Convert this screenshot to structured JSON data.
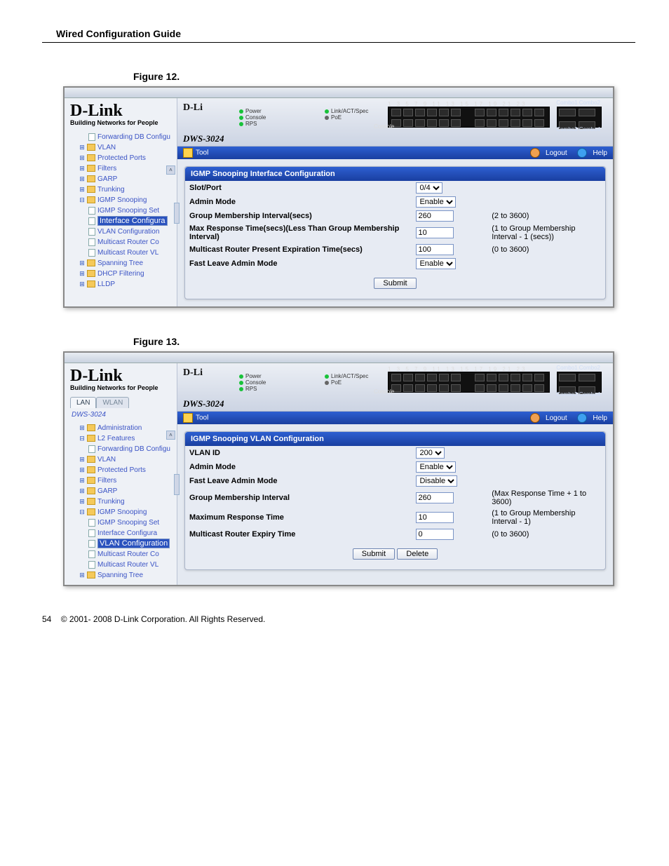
{
  "doc": {
    "header": "Wired Configuration Guide",
    "fig12": "Figure 12.",
    "fig13": "Figure 13.",
    "page_num": "54",
    "copyright": "© 2001- 2008 D-Link Corporation. All Rights Reserved."
  },
  "brand": {
    "logo": "D-Link",
    "tagline": "Building Networks for People",
    "mini": "D-Li",
    "model": "DWS-3024"
  },
  "device": {
    "leds": {
      "power": "Power",
      "console": "Console",
      "rps": "RPS",
      "linkact": "Link/ACT/Spec",
      "poe": "PoE"
    },
    "top_nums": "1   3   5   7   9   11        13   15   17   19   21  23",
    "bot_nums": "2   4   6   8  10  12        14  16  18  20  22  24",
    "console_port": "Console",
    "combo_top": "Combo1 Combo2",
    "combo_bot": "Combo3 Combo4"
  },
  "toolbar": {
    "tool": "Tool",
    "logout": "Logout",
    "help": "Help"
  },
  "tabs": {
    "lan": "LAN",
    "wlan": "WLAN"
  },
  "tree12": [
    {
      "lvl": 2,
      "kind": "page",
      "text": "Forwarding DB Configu"
    },
    {
      "lvl": 1,
      "kind": "folder",
      "text": "VLAN"
    },
    {
      "lvl": 1,
      "kind": "folder",
      "text": "Protected Ports"
    },
    {
      "lvl": 1,
      "kind": "folder",
      "text": "Filters"
    },
    {
      "lvl": 1,
      "kind": "folder",
      "text": "GARP"
    },
    {
      "lvl": 1,
      "kind": "folder",
      "text": "Trunking"
    },
    {
      "lvl": 1,
      "kind": "folder-open",
      "text": "IGMP Snooping"
    },
    {
      "lvl": 2,
      "kind": "page",
      "text": "IGMP Snooping Set"
    },
    {
      "lvl": 2,
      "kind": "page",
      "text": "Interface Configura",
      "sel": true
    },
    {
      "lvl": 2,
      "kind": "page",
      "text": "VLAN Configuration"
    },
    {
      "lvl": 2,
      "kind": "page",
      "text": "Multicast Router Co"
    },
    {
      "lvl": 2,
      "kind": "page",
      "text": "Multicast Router VL"
    },
    {
      "lvl": 1,
      "kind": "folder",
      "text": "Spanning Tree"
    },
    {
      "lvl": 1,
      "kind": "folder",
      "text": "DHCP Filtering"
    },
    {
      "lvl": 1,
      "kind": "folder",
      "text": "LLDP"
    }
  ],
  "tree13": [
    {
      "lvl": 0,
      "kind": "device",
      "text": "DWS-3024"
    },
    {
      "lvl": 1,
      "kind": "folder",
      "text": "Administration"
    },
    {
      "lvl": 1,
      "kind": "folder-open",
      "text": "L2 Features"
    },
    {
      "lvl": 2,
      "kind": "page",
      "text": "Forwarding DB Configu"
    },
    {
      "lvl": 1,
      "kind": "folder",
      "text": "VLAN"
    },
    {
      "lvl": 1,
      "kind": "folder",
      "text": "Protected Ports"
    },
    {
      "lvl": 1,
      "kind": "folder",
      "text": "Filters"
    },
    {
      "lvl": 1,
      "kind": "folder",
      "text": "GARP"
    },
    {
      "lvl": 1,
      "kind": "folder",
      "text": "Trunking"
    },
    {
      "lvl": 1,
      "kind": "folder-open",
      "text": "IGMP Snooping"
    },
    {
      "lvl": 2,
      "kind": "page",
      "text": "IGMP Snooping Set"
    },
    {
      "lvl": 2,
      "kind": "page",
      "text": "Interface Configura"
    },
    {
      "lvl": 2,
      "kind": "page",
      "text": "VLAN Configuration",
      "sel": true
    },
    {
      "lvl": 2,
      "kind": "page",
      "text": "Multicast Router Co"
    },
    {
      "lvl": 2,
      "kind": "page",
      "text": "Multicast Router VL"
    },
    {
      "lvl": 1,
      "kind": "folder",
      "text": "Spanning Tree"
    }
  ],
  "fig12": {
    "title": "IGMP Snooping Interface Configuration",
    "rows": [
      {
        "label": "Slot/Port",
        "ctrl": "select",
        "value": "0/4",
        "hint": ""
      },
      {
        "label": "Admin Mode",
        "ctrl": "select",
        "value": "Enable",
        "hint": ""
      },
      {
        "label": "Group Membership Interval(secs)",
        "ctrl": "input",
        "value": "260",
        "hint": "(2 to 3600)"
      },
      {
        "label": "Max Response Time(secs)(Less Than Group Membership Interval)",
        "ctrl": "input",
        "value": "10",
        "hint": "(1 to Group Membership Interval - 1 (secs))"
      },
      {
        "label": "Multicast Router Present Expiration Time(secs)",
        "ctrl": "input",
        "value": "100",
        "hint": "(0 to 3600)"
      },
      {
        "label": "Fast Leave Admin Mode",
        "ctrl": "select",
        "value": "Enable",
        "hint": ""
      }
    ],
    "submit": "Submit"
  },
  "fig13": {
    "title": "IGMP Snooping VLAN Configuration",
    "rows": [
      {
        "label": "VLAN ID",
        "ctrl": "select",
        "value": "200",
        "hint": ""
      },
      {
        "label": "Admin Mode",
        "ctrl": "select",
        "value": "Enable",
        "hint": ""
      },
      {
        "label": "Fast Leave Admin Mode",
        "ctrl": "select",
        "value": "Disable",
        "hint": ""
      },
      {
        "label": "Group Membership Interval",
        "ctrl": "input",
        "value": "260",
        "hint": "(Max Response Time + 1 to 3600)"
      },
      {
        "label": "Maximum Response Time",
        "ctrl": "input",
        "value": "10",
        "hint": "(1 to Group Membership Interval - 1)"
      },
      {
        "label": "Multicast Router Expiry Time",
        "ctrl": "input",
        "value": "0",
        "hint": "(0 to 3600)"
      }
    ],
    "submit": "Submit",
    "delete": "Delete"
  }
}
